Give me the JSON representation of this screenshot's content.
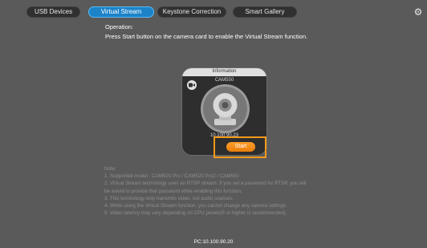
{
  "tabs": [
    {
      "label": "USB Devices",
      "active": false
    },
    {
      "label": "Virtual Stream",
      "active": true
    },
    {
      "label": "Keystone Correction",
      "active": false
    },
    {
      "label": "Smart Gallery",
      "active": false
    }
  ],
  "operation": {
    "title": "Operation:",
    "text": "Press Start button on the camera card to enable the Virtual Stream function."
  },
  "card": {
    "header": "Information",
    "model": "CAM550",
    "ip": "10.100.90.23",
    "start_label": "Start",
    "video_icon": "video-camera-icon",
    "preview_icon": "ptz-camera-icon"
  },
  "notes": {
    "title": "Note:",
    "items": [
      "1. Supported model : CAM520 Pro / CAM520 Pro2 / CAM550",
      "2. Virtual Stream technology uses an RTSP stream. If you set a password for RTSP, you will",
      "be asked to provide that password while enabling this function.",
      "3. This technology only transmits video, not audio sources.",
      "4. While using the Virtual Stream function, you cannot change any camera settings.",
      "5. Video latency may vary depending on CPU power(i5 or higher is recommended)."
    ]
  },
  "footer": {
    "pc_ip": "PC:10.100.90.20"
  },
  "colors": {
    "active_tab": "#1c83c9",
    "start_button": "#f5901c",
    "highlight_outline": "#f39a1a",
    "background": "#5a5a5a"
  },
  "icons": {
    "settings": "gear-icon"
  }
}
